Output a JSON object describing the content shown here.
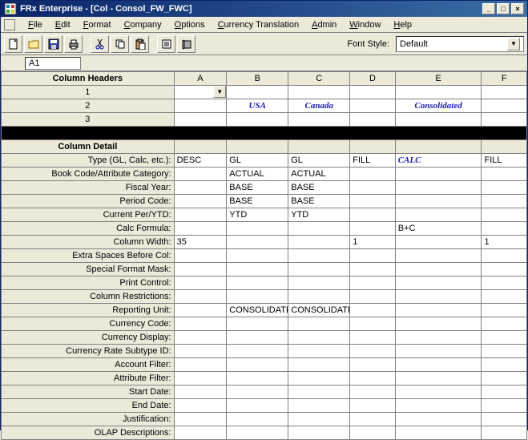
{
  "window": {
    "title": "FRx Enterprise - [Col - Consol_FW_FWC]"
  },
  "menus": [
    "File",
    "Edit",
    "Format",
    "Company",
    "Options",
    "Currency Translation",
    "Admin",
    "Window",
    "Help"
  ],
  "toolbar": {
    "fontstyle_label": "Font Style:",
    "fontstyle_value": "Default"
  },
  "cellref": "A1",
  "columns": [
    "A",
    "B",
    "C",
    "D",
    "E",
    "F"
  ],
  "headers_title": "Column Headers",
  "header_rows": [
    "1",
    "2",
    "3"
  ],
  "header_vals": {
    "r2": {
      "B": "USA",
      "C": "Canada",
      "E": "Consolidated"
    }
  },
  "detail_title": "Column Detail",
  "detail_rows": [
    {
      "label": "Type (GL, Calc, etc.):",
      "cells": [
        "DESC",
        "GL",
        "GL",
        "FILL",
        "CALC",
        "FILL"
      ],
      "calc_col": 4
    },
    {
      "label": "Book Code/Attribute Category:",
      "cells": [
        "",
        "ACTUAL",
        "ACTUAL",
        "",
        "",
        ""
      ]
    },
    {
      "label": "Fiscal Year:",
      "cells": [
        "",
        "BASE",
        "BASE",
        "",
        "",
        ""
      ]
    },
    {
      "label": "Period Code:",
      "cells": [
        "",
        "BASE",
        "BASE",
        "",
        "",
        ""
      ]
    },
    {
      "label": "Current Per/YTD:",
      "cells": [
        "",
        "YTD",
        "YTD",
        "",
        "",
        ""
      ]
    },
    {
      "label": "Calc Formula:",
      "cells": [
        "",
        "",
        "",
        "",
        "B+C",
        ""
      ]
    },
    {
      "label": "Column Width:",
      "cells": [
        "35",
        "",
        "",
        "1",
        "",
        "1"
      ]
    },
    {
      "label": "Extra Spaces Before Col:",
      "cells": [
        "",
        "",
        "",
        "",
        "",
        ""
      ]
    },
    {
      "label": "Special Format Mask:",
      "cells": [
        "",
        "",
        "",
        "",
        "",
        ""
      ]
    },
    {
      "label": "Print Control:",
      "cells": [
        "",
        "",
        "",
        "",
        "",
        ""
      ]
    },
    {
      "label": "Column Restrictions:",
      "cells": [
        "",
        "",
        "",
        "",
        "",
        ""
      ]
    },
    {
      "label": "Reporting Unit:",
      "cells": [
        "",
        "CONSOLIDATE",
        "CONSOLIDATED^FABRIKAM CAN",
        "",
        "",
        ""
      ]
    },
    {
      "label": "Currency Code:",
      "cells": [
        "",
        "",
        "",
        "",
        "",
        ""
      ]
    },
    {
      "label": "Currency Display:",
      "cells": [
        "",
        "",
        "",
        "",
        "",
        ""
      ]
    },
    {
      "label": "Currency Rate Subtype ID:",
      "cells": [
        "",
        "",
        "",
        "",
        "",
        ""
      ]
    },
    {
      "label": "Account Filter:",
      "cells": [
        "",
        "",
        "",
        "",
        "",
        ""
      ]
    },
    {
      "label": "Attribute Filter:",
      "cells": [
        "",
        "",
        "",
        "",
        "",
        ""
      ]
    },
    {
      "label": "Start Date:",
      "cells": [
        "",
        "",
        "",
        "",
        "",
        ""
      ]
    },
    {
      "label": "End Date:",
      "cells": [
        "",
        "",
        "",
        "",
        "",
        ""
      ]
    },
    {
      "label": "Justification:",
      "cells": [
        "",
        "",
        "",
        "",
        "",
        ""
      ]
    },
    {
      "label": "OLAP Descriptions:",
      "cells": [
        "",
        "",
        "",
        "",
        "",
        ""
      ]
    }
  ]
}
